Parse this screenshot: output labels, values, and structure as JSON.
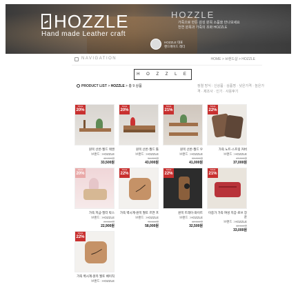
{
  "banner": {
    "brand": "HOZZLE",
    "subtitle": "Hand made Leather craft",
    "tagline": "HOZZLE",
    "line1": "가죽으로 만든 감성 원목 소품을 만나보세요",
    "line2": "천연 원목과 가죽의 조화 HOZZLE",
    "sig1": "HOZZLE 대표",
    "sig2": "핸드메이드 레더"
  },
  "nav": {
    "label": "NAVIGATION",
    "breadcrumb": "HOME > 브랜드샵 > HOZZLE"
  },
  "category": {
    "title": "H O Z Z L E"
  },
  "product_list": {
    "label": "PRODUCT LIST",
    "sep": ">",
    "category": "HOZZLE",
    "count_text": "총 9 상품",
    "sorts": "정렬 방식 : 신상품 · 상품명 · 낮은가격 · 높은가격 · 제조사 · 인기 · 사용후기"
  },
  "products": [
    {
      "name": "원목 선반-월드 랙앤",
      "brand": "브랜드 : HOZZLE",
      "original": "42,000원",
      "price": "33,500원",
      "badge_label": "SALE",
      "discount": "20%"
    },
    {
      "name": "원목 선반-월드 툴",
      "brand": "브랜드 : HOZZLE",
      "original": "54,000원",
      "price": "43,000원",
      "badge_label": "SALE",
      "discount": "20%"
    },
    {
      "name": "원목 선반-월드 우",
      "brand": "브랜드 : HOZZLE",
      "original": "53,000원",
      "price": "41,000원",
      "badge_label": "SALE",
      "discount": "21%"
    },
    {
      "name": "가죽 노트-스프링 커버",
      "brand": "브랜드 : HOZZLE",
      "original": "47,000원",
      "price": "37,000원",
      "badge_label": "SALE",
      "discount": "22%"
    },
    {
      "name": "가죽 저금-필터 박스",
      "brand": "브랜드 : HOZZLE",
      "original": "29,000원",
      "price": "22,900원",
      "badge_label": "SALE",
      "discount": "20%"
    },
    {
      "name": "가죽 벽시계-원목 월토 르연 프",
      "brand": "브랜드 : HOZZLE",
      "original": "75,000원",
      "price": "58,000원",
      "badge_label": "SALE",
      "discount": "22%"
    },
    {
      "name": "원목 트레이-와이트",
      "brand": "브랜드 : HOZZLE",
      "original": "42,000원",
      "price": "32,500원",
      "badge_label": "SALE",
      "discount": "22%"
    },
    {
      "name": "이중가 가죽 여성 지갑-로브 장윤",
      "brand": "브랜드 : HOZZLE",
      "original": "42,000원",
      "price": "33,000원",
      "badge_label": "SALE",
      "discount": "21%"
    },
    {
      "name": "가죽 벽시계-원목 월토 베이직",
      "brand": "브랜드 : HOZZLE",
      "original": "",
      "price": "",
      "badge_label": "SALE",
      "discount": "22%"
    }
  ],
  "colors": {
    "badge": "#c8302f",
    "badge_pale": "#e9a9a8",
    "clock": "#c59267"
  }
}
